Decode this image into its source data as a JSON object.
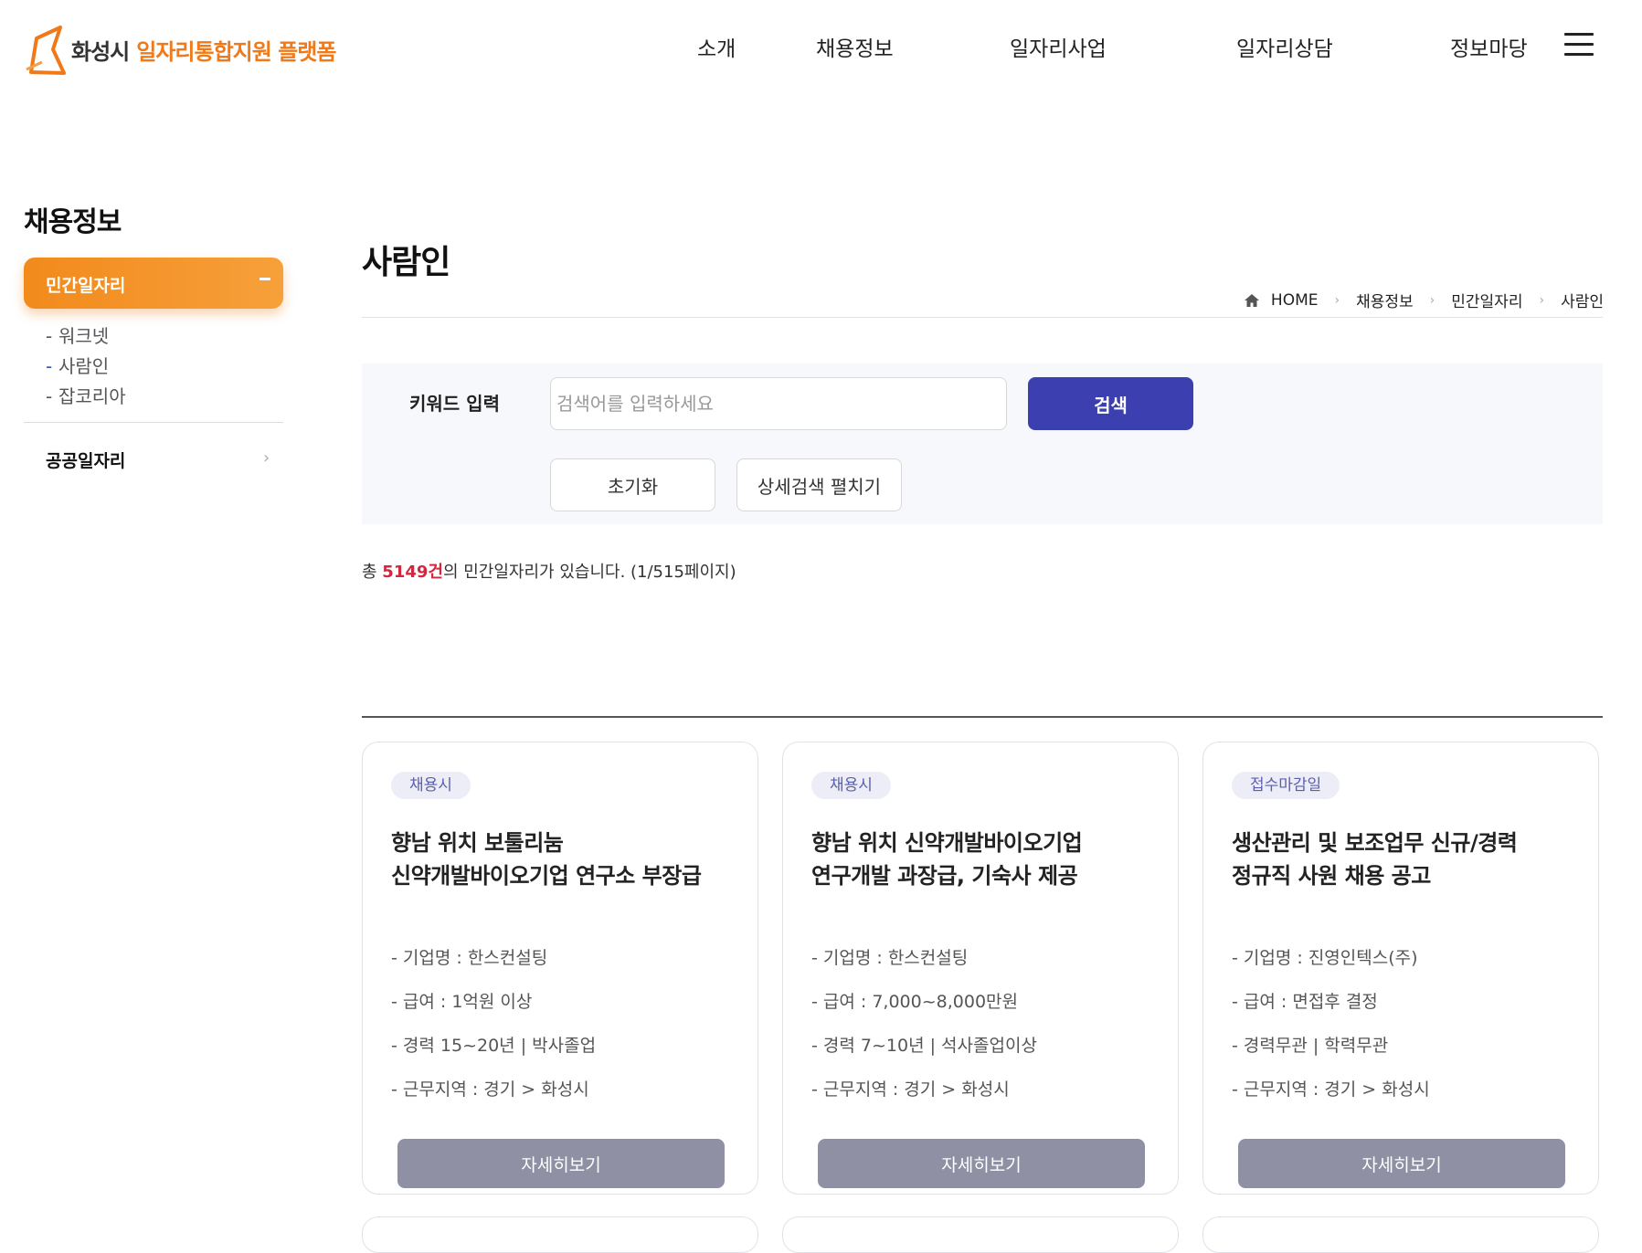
{
  "header": {
    "logo_city": "화성시",
    "logo_title": "일자리통합지원 플랫폼",
    "nav": [
      {
        "label": "소개"
      },
      {
        "label": "채용정보"
      },
      {
        "label": "일자리사업"
      },
      {
        "label": "일자리상담"
      },
      {
        "label": "정보마당"
      }
    ],
    "menu_icon": "hamburger-icon"
  },
  "sidebar": {
    "title": "채용정보",
    "active_item": "민간일자리",
    "sub_items": [
      {
        "label": "워크넷"
      },
      {
        "label": "사람인"
      },
      {
        "label": "잡코리아"
      }
    ],
    "other_item": "공공일자리",
    "other_arrow": "›"
  },
  "content": {
    "title": "사람인",
    "breadcrumb": [
      "HOME",
      "채용정보",
      "민간일자리",
      "사람인"
    ],
    "breadcrumb_sep": "›",
    "search": {
      "label": "키워드 입력",
      "placeholder": "검색어를 입력하세요",
      "value": "",
      "search_button": "검색",
      "reset_button": "초기화",
      "advanced_button": "상세검색 펼치기"
    },
    "total": {
      "prefix": "총 ",
      "count": "5149건",
      "suffix": "의 민간일자리가 있습니다. (1/515페이지)"
    }
  },
  "cards": [
    {
      "badge": "채용시",
      "title_lines": [
        "향남 위치 보툴리눔",
        "신약개발바이오기업 연구소 부장급"
      ],
      "company": "- 기업명 : 한스컨설팅",
      "salary": "- 급여 : 1억원 이상",
      "career": "- 경력 15~20년 | 박사졸업",
      "location": "- 근무지역 : 경기 > 화성시",
      "button": "자세히보기"
    },
    {
      "badge": "채용시",
      "title_lines": [
        "향남 위치 신약개발바이오기업",
        "연구개발 과장급, 기숙사 제공"
      ],
      "company": "- 기업명 : 한스컨설팅",
      "salary": "- 급여 : 7,000~8,000만원",
      "career": "- 경력 7~10년 | 석사졸업이상",
      "location": "- 근무지역 : 경기 > 화성시",
      "button": "자세히보기"
    },
    {
      "badge": "접수마감일",
      "title_lines": [
        "생산관리 및 보조업무 신규/경력",
        "정규직 사원 채용 공고"
      ],
      "company": "- 기업명 : 진영인텍스(주)",
      "salary": "- 급여 : 면접후 결정",
      "career": "- 경력무관 | 학력무관",
      "location": "- 근무지역 : 경기 > 화성시",
      "button": "자세히보기"
    }
  ],
  "colors": {
    "brand_orange": "#f07a1a",
    "search_blue": "#3b3fb0",
    "count_red": "#d3263f",
    "card_button": "#8f90a3"
  }
}
